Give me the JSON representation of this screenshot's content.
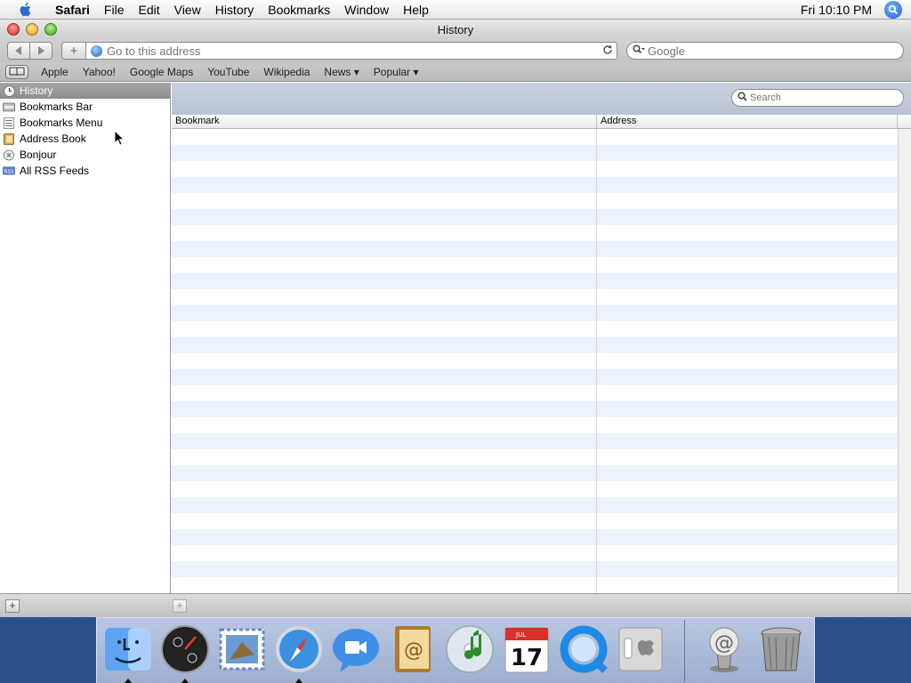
{
  "menubar": {
    "app": "Safari",
    "items": [
      "File",
      "Edit",
      "View",
      "History",
      "Bookmarks",
      "Window",
      "Help"
    ],
    "clock": "Fri 10:10 PM"
  },
  "window": {
    "title": "History"
  },
  "toolbar": {
    "address_placeholder": "Go to this address",
    "search_placeholder": "Google"
  },
  "bookmarks_bar": {
    "items": [
      "Apple",
      "Yahoo!",
      "Google Maps",
      "YouTube",
      "Wikipedia",
      "News ▾",
      "Popular ▾"
    ]
  },
  "sidebar": {
    "items": [
      {
        "label": "History",
        "icon": "clock-icon"
      },
      {
        "label": "Bookmarks Bar",
        "icon": "bookmarks-bar-icon"
      },
      {
        "label": "Bookmarks Menu",
        "icon": "bookmarks-menu-icon"
      },
      {
        "label": "Address Book",
        "icon": "address-book-icon"
      },
      {
        "label": "Bonjour",
        "icon": "bonjour-icon"
      },
      {
        "label": "All RSS Feeds",
        "icon": "rss-icon"
      }
    ]
  },
  "main": {
    "search_placeholder": "Search",
    "columns": [
      "Bookmark",
      "Address"
    ]
  },
  "dock": {
    "items": [
      "Finder",
      "Dashboard",
      "Mail",
      "Safari",
      "iChat",
      "Address Book",
      "iTunes",
      "iCal",
      "QuickTime Player",
      "System Preferences",
      "Mail Downloads",
      "Trash"
    ],
    "ical_month": "JUL",
    "ical_day": "17"
  },
  "colors": {
    "selection": "#8d8d8d",
    "stripe": "#edf3fe",
    "desktop": "#2b4f8c"
  }
}
